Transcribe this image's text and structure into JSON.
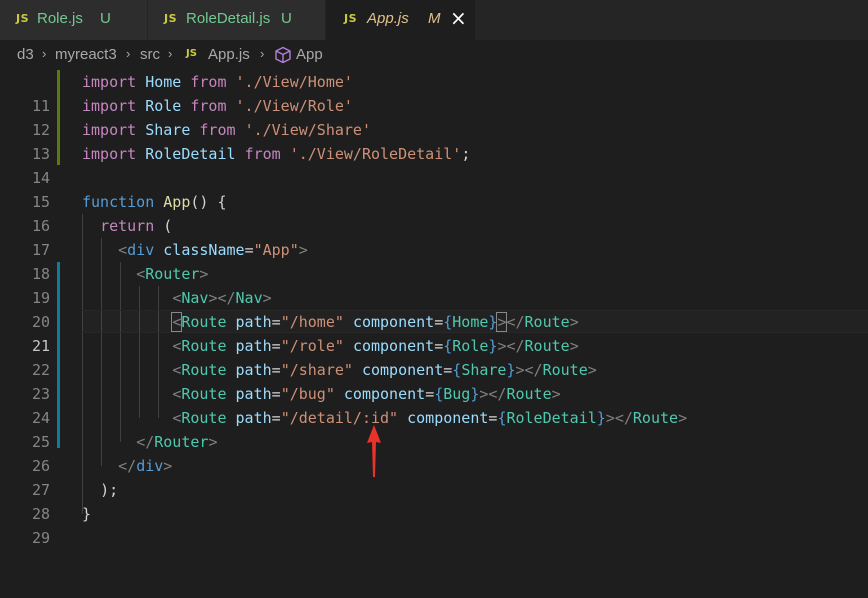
{
  "tabs": [
    {
      "icon": "JS",
      "name": "Role.js",
      "status": "U"
    },
    {
      "icon": "JS",
      "name": "RoleDetail.js",
      "status": "U"
    },
    {
      "icon": "JS",
      "name": "App.js",
      "status": "M",
      "close": "×"
    }
  ],
  "breadcrumb": {
    "items": [
      "d3",
      "myreact3",
      "src"
    ],
    "file_icon": "JS",
    "file": "App.js",
    "symbol": "App",
    "separator": "›"
  },
  "lines": [
    "11",
    "12",
    "13",
    "14",
    "15",
    "16",
    "17",
    "18",
    "19",
    "20",
    "21",
    "22",
    "23",
    "24",
    "25",
    "26",
    "27",
    "28",
    "29"
  ],
  "code": {
    "import": "import",
    "from": "from",
    "home_id": "Home",
    "home_path": "'./View/Home'",
    "role_id": "Role",
    "role_path": "'./View/Role'",
    "share_id": "Share",
    "share_path": "'./View/Share'",
    "rd_id": "RoleDetail",
    "rd_path": "'./View/RoleDetail'",
    "semicolon": ";",
    "function": "function",
    "app": "App",
    "app_sig": "() {",
    "return": "return",
    "paren_open": "(",
    "lt": "<",
    "gt": ">",
    "ltslash": "</",
    "selfclose": "></",
    "div": "div",
    "classname": "className",
    "eq": "=",
    "app_str": "\"App\"",
    "router": "Router",
    "nav": "Nav",
    "route": "Route",
    "path": "path",
    "component": "component",
    "lbrace": "{",
    "rbrace": "}",
    "p_home": "\"/home\"",
    "p_role": "\"/role\"",
    "p_share": "\"/share\"",
    "p_bug": "\"/bug\"",
    "p_detail": "\"/detail/:id\"",
    "c_home": "Home",
    "c_role": "Role",
    "c_share": "Share",
    "c_bug": "Bug",
    "c_rd": "RoleDetail",
    "close_paren": ");",
    "close_brace": "}"
  },
  "colors": {
    "keyword": "#c586c0",
    "string": "#ce9178",
    "variable": "#9cdcfe",
    "tag": "#569cd6",
    "component": "#4ec9b0",
    "annotation_arrow": "#e8332b"
  }
}
